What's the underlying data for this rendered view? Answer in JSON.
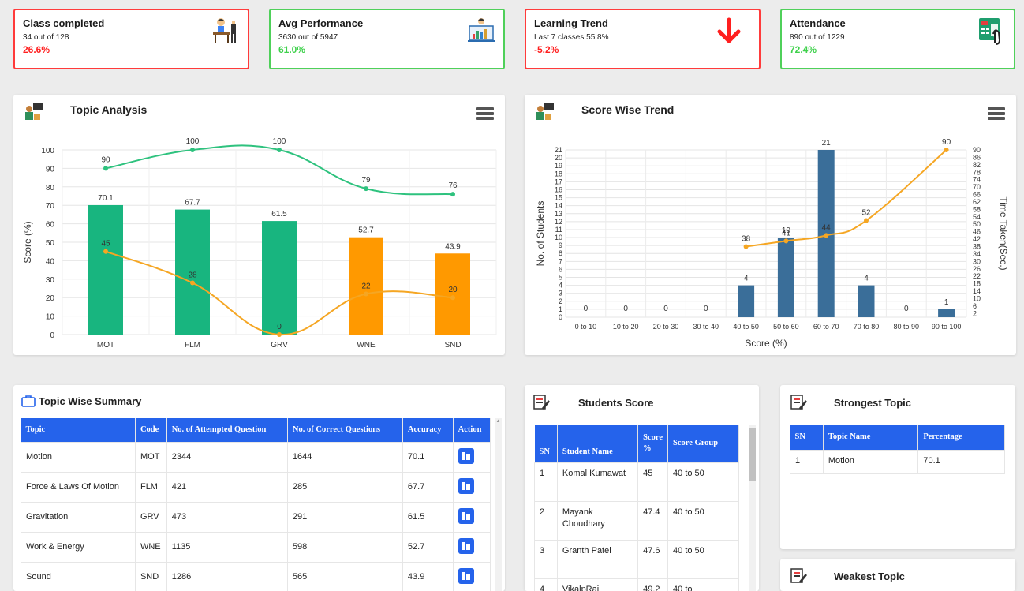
{
  "stats": [
    {
      "title": "Class completed",
      "sub": "34 out of 128",
      "pct": "26.6%",
      "tone": "red",
      "icon": "teacher-desk-icon"
    },
    {
      "title": "Avg Performance",
      "sub": "3630 out of 5947",
      "pct": "61.0%",
      "tone": "green",
      "icon": "presentation-board-icon"
    },
    {
      "title": "Learning Trend",
      "sub": "Last 7 classes 55.8%",
      "pct": "-5.2%",
      "tone": "red",
      "icon": "arrow-down-icon"
    },
    {
      "title": "Attendance",
      "sub": "890 out of 1229",
      "pct": "72.4%",
      "tone": "green",
      "icon": "fingerprint-scanner-icon"
    }
  ],
  "topic_analysis": {
    "title": "Topic Analysis"
  },
  "score_trend": {
    "title": "Score Wise Trend"
  },
  "chart_data": [
    {
      "type": "bar",
      "categories": [
        "MOT",
        "FLM",
        "GRV",
        "WNE",
        "SND"
      ],
      "series": [
        {
          "values": [
            70.1,
            67.7,
            61.5,
            52.7,
            43.9
          ],
          "colors": [
            "#18b57f",
            "#18b57f",
            "#18b57f",
            "#ff9900",
            "#ff9900"
          ]
        },
        {
          "values": [
            90,
            100,
            100,
            79,
            76
          ],
          "kind": "line",
          "color": "#2ec27e"
        },
        {
          "values": [
            45,
            28,
            0,
            22,
            20
          ],
          "kind": "line",
          "color": "#f5a623"
        }
      ],
      "ylabel": "Score (%)",
      "ylim": [
        0,
        100
      ],
      "yticks": [
        0,
        10,
        20,
        30,
        40,
        50,
        60,
        70,
        80,
        90,
        100
      ]
    },
    {
      "type": "bar",
      "categories": [
        "0 to 10",
        "10 to 20",
        "20 to 30",
        "30 to 40",
        "40 to 50",
        "50 to 60",
        "60 to 70",
        "70 to 80",
        "80 to 90",
        "90 to 100"
      ],
      "series": [
        {
          "values": [
            0,
            0,
            0,
            0,
            4,
            10,
            21,
            4,
            0,
            1
          ],
          "color": "#3a6e99"
        },
        {
          "values": [
            null,
            null,
            null,
            null,
            38,
            41,
            44,
            52,
            null,
            90
          ],
          "kind": "line",
          "axis": "right",
          "color": "#f5a623"
        }
      ],
      "xlabel": "Score (%)",
      "ylabel": "No. of Students",
      "y2label": "Time Taken(Sec.)",
      "ylim": [
        0,
        21
      ],
      "y2lim": [
        0,
        90
      ],
      "yticks": [
        0,
        1,
        2,
        3,
        4,
        5,
        6,
        7,
        8,
        9,
        10,
        11,
        12,
        13,
        14,
        15,
        16,
        17,
        18,
        19,
        20,
        21
      ],
      "y2ticks": [
        2,
        6,
        10,
        14,
        18,
        22,
        26,
        30,
        34,
        38,
        42,
        46,
        50,
        54,
        58,
        62,
        66,
        70,
        74,
        78,
        82,
        86,
        90
      ]
    }
  ],
  "topic_summary": {
    "title": "Topic Wise Summary",
    "headers": [
      "Topic",
      "Code",
      "No. of Attempted Question",
      "No. of Correct Questions",
      "Accuracy",
      "Action"
    ],
    "rows": [
      [
        "Motion",
        "MOT",
        "2344",
        "1644",
        "70.1"
      ],
      [
        "Force & Laws Of Motion",
        "FLM",
        "421",
        "285",
        "67.7"
      ],
      [
        "Gravitation",
        "GRV",
        "473",
        "291",
        "61.5"
      ],
      [
        "Work & Energy",
        "WNE",
        "1135",
        "598",
        "52.7"
      ],
      [
        "Sound",
        "SND",
        "1286",
        "565",
        "43.9"
      ]
    ]
  },
  "students_score": {
    "title": "Students Score",
    "headers": [
      "SN",
      "Student Name",
      "Score %",
      "Score Group"
    ],
    "rows": [
      [
        "1",
        "Komal Kumawat",
        "45",
        "40 to 50"
      ],
      [
        "2",
        "Mayank Choudhary",
        "47.4",
        "40 to 50"
      ],
      [
        "3",
        "Granth Patel",
        "47.6",
        "40 to 50"
      ],
      [
        "4",
        "VikalpRaj",
        "49.2",
        "40 to"
      ]
    ]
  },
  "strongest_topic": {
    "title": "Strongest Topic",
    "headers": [
      "SN",
      "Topic Name",
      "Percentage"
    ],
    "rows": [
      [
        "1",
        "Motion",
        "70.1"
      ]
    ]
  },
  "weakest_topic": {
    "title": "Weakest Topic"
  }
}
